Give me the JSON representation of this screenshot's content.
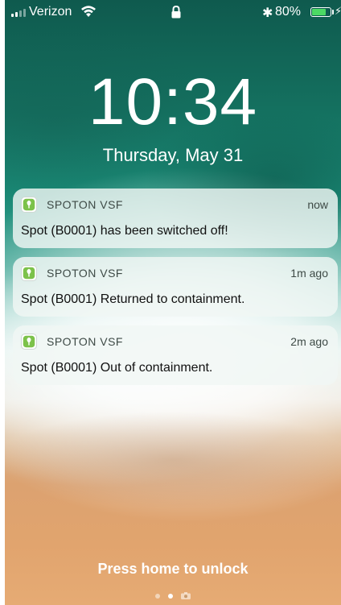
{
  "status_bar": {
    "carrier": "Verizon",
    "bluetooth_glyph": "✱",
    "battery_percent": "80%",
    "battery_level": 0.8,
    "charging_glyph": "⚡",
    "battery_color": "#4cd964"
  },
  "lock_screen": {
    "time": "10:34",
    "date": "Thursday, May 31"
  },
  "notifications": [
    {
      "app": "SPOTON VSF",
      "time": "now",
      "message": "Spot (B0001)  has been switched off!"
    },
    {
      "app": "SPOTON VSF",
      "time": "1m ago",
      "message": "Spot (B0001) Returned to containment."
    },
    {
      "app": "SPOTON VSF",
      "time": "2m ago",
      "message": "Spot (B0001) Out of containment."
    }
  ],
  "app_icon": {
    "name": "spoton-app-icon",
    "color": "#7cc24a"
  },
  "bottom": {
    "unlock_hint": "Press home to unlock",
    "page_indicator": {
      "pages": 2,
      "current": 1,
      "extra": "camera-icon"
    }
  }
}
